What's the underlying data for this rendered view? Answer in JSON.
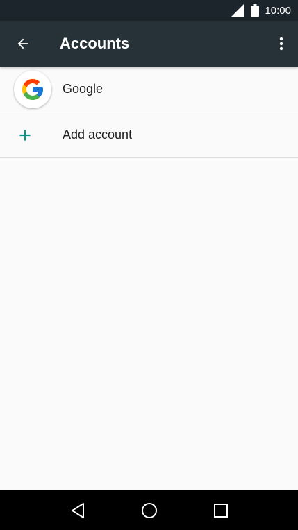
{
  "status_bar": {
    "time": "10:00",
    "icons": [
      "signal-icon",
      "battery-icon"
    ]
  },
  "app_bar": {
    "title": "Accounts",
    "back_icon": "arrow-back-icon",
    "menu_icon": "more-vert-icon",
    "background": "#263238"
  },
  "accounts": {
    "items": [
      {
        "label": "Google",
        "icon": "google-logo-icon"
      },
      {
        "label": "Add account",
        "icon": "plus-icon",
        "accent": "#009688"
      }
    ]
  },
  "nav_bar": {
    "buttons": [
      "back-triangle-icon",
      "home-circle-icon",
      "recents-square-icon"
    ]
  }
}
